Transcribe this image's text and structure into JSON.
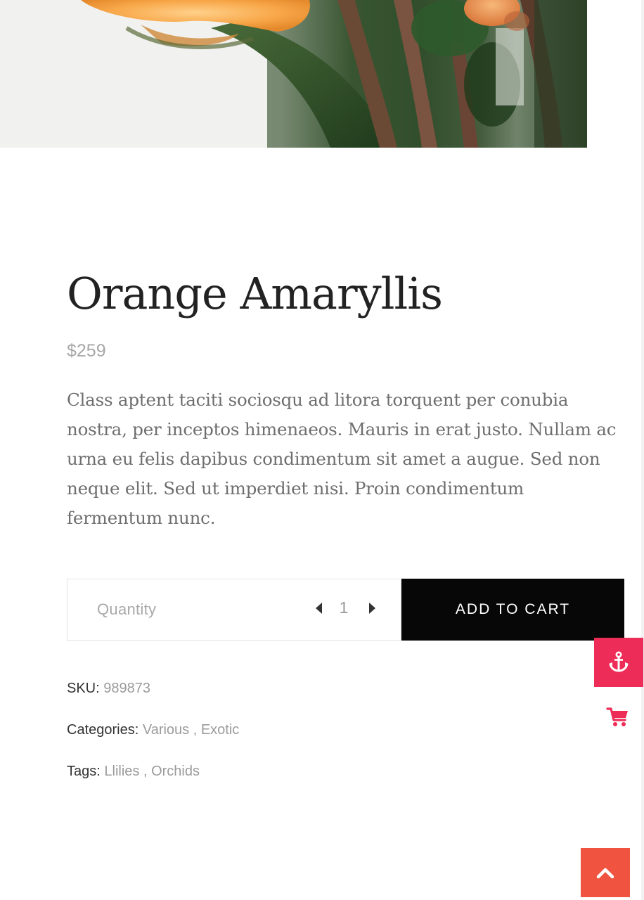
{
  "product": {
    "title": "Orange Amaryllis",
    "price": "$259",
    "description": "Class aptent taciti sociosqu ad litora torquent per conubia nostra, per inceptos himenaeos. Mauris in erat justo. Nullam ac urna eu felis dapibus condimentum sit amet a augue. Sed non neque elit. Sed ut imperdiet nisi. Proin condimentum fermentum nunc.",
    "image_icon": "orange-flower-photo"
  },
  "cart_form": {
    "quantity_label": "Quantity",
    "quantity_value": "1",
    "decrease_icon": "caret-left-icon",
    "increase_icon": "caret-right-icon",
    "add_to_cart_label": "ADD TO CART"
  },
  "meta": {
    "sku_label": "SKU:",
    "sku_value": "989873",
    "categories_label": "Categories:",
    "categories": [
      "Various",
      "Exotic"
    ],
    "tags_label": "Tags:",
    "tags": [
      "Llilies",
      "Orchids"
    ],
    "separator": " , "
  },
  "floating": {
    "anchor_icon": "anchor-icon",
    "cart_icon": "shopping-cart-icon",
    "scroll_top_icon": "chevron-up-icon"
  },
  "colors": {
    "accent_pink": "#ee2c58",
    "scroll_top_red": "#f05340",
    "button_black": "#070707"
  }
}
